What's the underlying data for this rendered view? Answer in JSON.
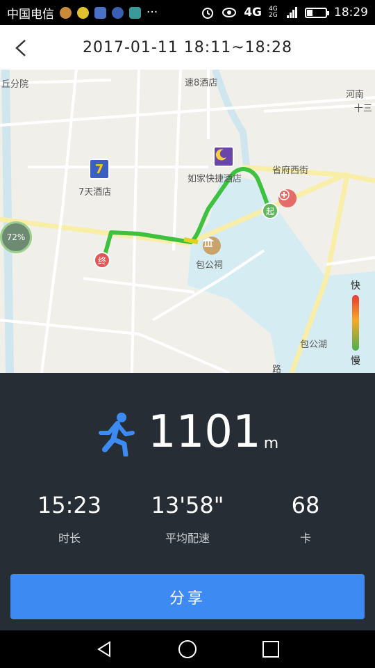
{
  "status_bar": {
    "carrier": "中国电信",
    "network": "4G",
    "network_small": "4G 2G",
    "time": "18:29",
    "more": "···"
  },
  "header": {
    "title": "2017-01-11  18:11~18:28"
  },
  "map": {
    "labels": {
      "top_left": "丘分院",
      "hotel_top": "速8酒店",
      "hotel_7days": "7天酒店",
      "hotel_rujia": "如家快捷酒店",
      "street": "省府西街",
      "temple": "包公祠",
      "lake": "包公湖",
      "henan": "河南",
      "shisan": "十三",
      "road_partial": "路"
    },
    "markers": {
      "start": "起",
      "end": "终",
      "badge_7": "7",
      "avatar_percent": "72%"
    },
    "legend": {
      "fast": "快",
      "slow": "慢"
    }
  },
  "workout": {
    "distance": "1101",
    "distance_unit": "m",
    "duration": "15:23",
    "duration_label": "时长",
    "pace": "13'58\"",
    "pace_label": "平均配速",
    "calories": "68",
    "calories_label": "卡"
  },
  "share_label": "分享",
  "colors": {
    "accent": "#3d8bf2",
    "panel": "#262d34",
    "route": "#3ec13e"
  }
}
